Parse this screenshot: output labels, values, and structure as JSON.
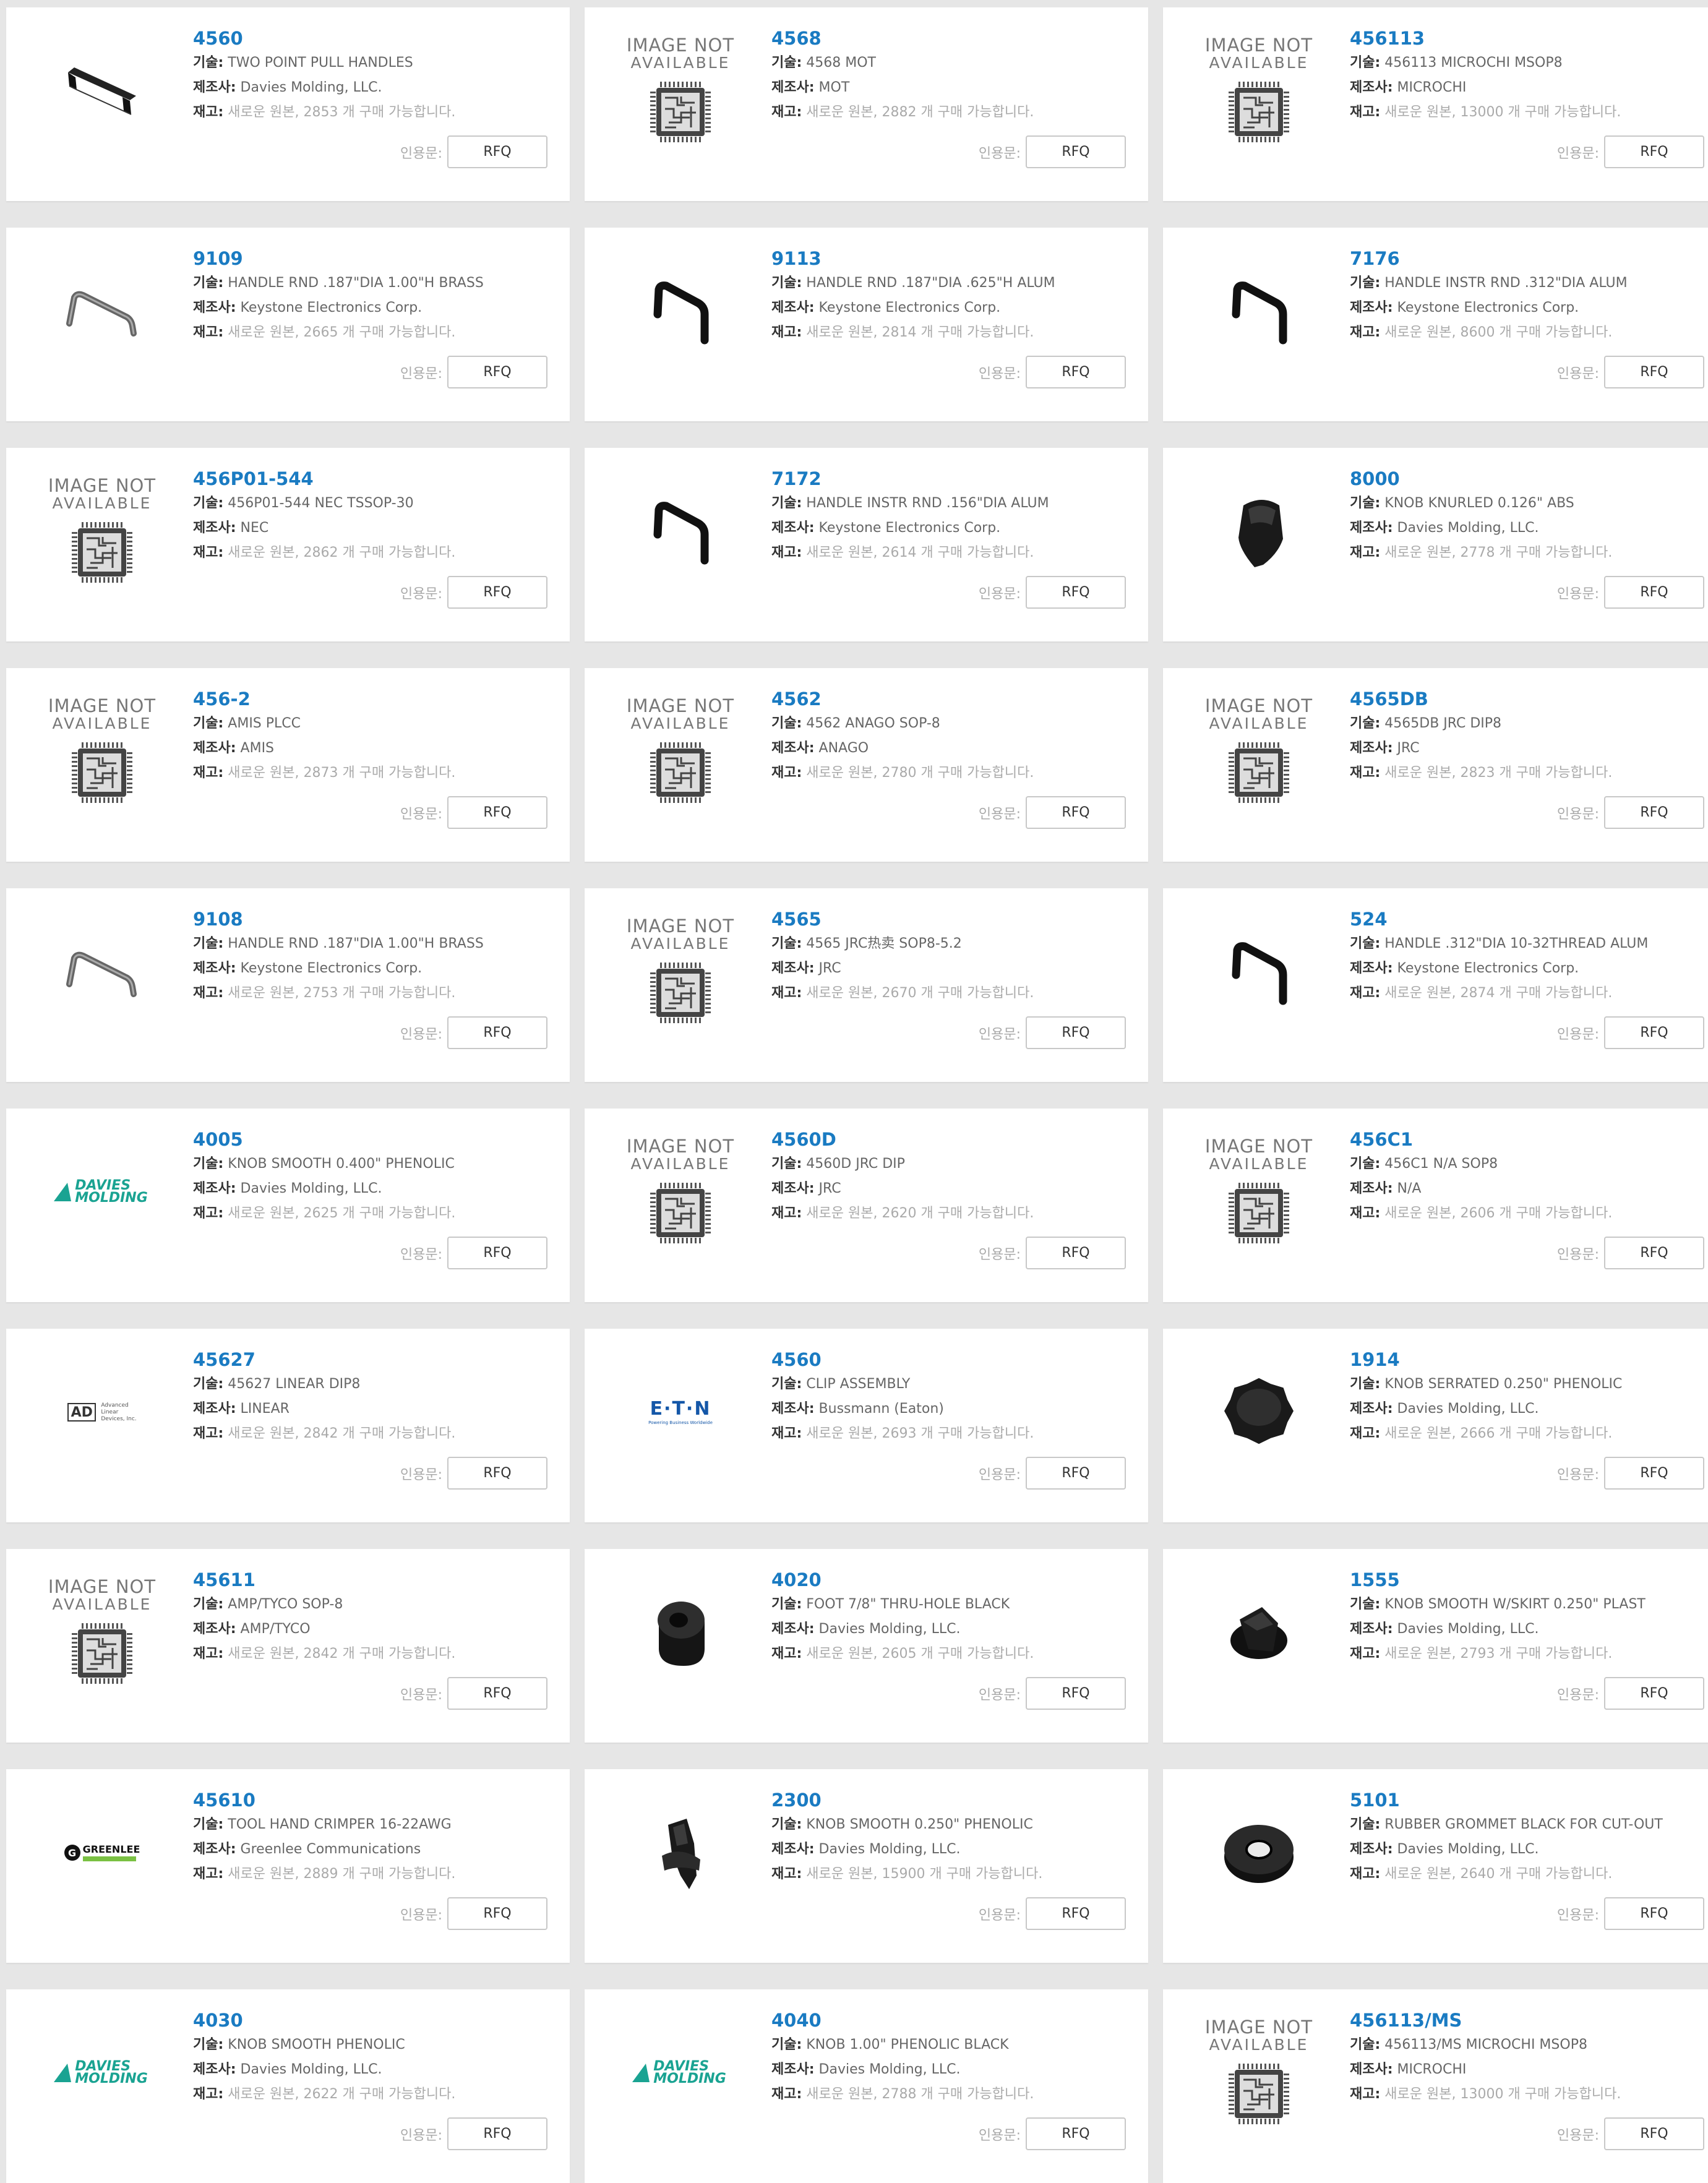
{
  "labels": {
    "desc": "기술:",
    "mfr": "제조사:",
    "stock": "재고:",
    "quote": "인용문:",
    "rfq": "RFQ",
    "image_not_available_1": "IMAGE NOT",
    "image_not_available_2": "AVAILABLE"
  },
  "logos": {
    "davies_line1": "DAVIES",
    "davies_line2": "MOLDING",
    "eaton": "E·T·N",
    "eaton_tagline": "Powering Business Worldwide",
    "greenlee_mark": "G",
    "greenlee": "GREENLEE",
    "ald_mark": "AD",
    "ald_line1": "Advanced",
    "ald_line2": "Linear",
    "ald_line3": "Devices, Inc."
  },
  "colors": {
    "link": "#1a7bc2",
    "davies": "#1aa392",
    "eaton": "#1457a8",
    "greenlee": "#7ac143"
  },
  "products": [
    {
      "pn": "4560",
      "desc": "TWO POINT PULL HANDLES",
      "mfr": "Davies Molding, LLC.",
      "stock": "새로운 원본, 2853 개 구매 가능합니다.",
      "thumb": "pull-handle"
    },
    {
      "pn": "4568",
      "desc": "4568 MOT",
      "mfr": "MOT",
      "stock": "새로운 원본, 2882 개 구매 가능합니다.",
      "thumb": "image-not-available"
    },
    {
      "pn": "456113",
      "desc": "456113 MICROCHI MSOP8",
      "mfr": "MICROCHI",
      "stock": "새로운 원본, 13000 개 구매 가능합니다.",
      "thumb": "image-not-available"
    },
    {
      "pn": "9109",
      "desc": "HANDLE RND .187\"DIA 1.00\"H BRASS",
      "mfr": "Keystone Electronics Corp.",
      "stock": "새로운 원본, 2665 개 구매 가능합니다.",
      "thumb": "handle-silver"
    },
    {
      "pn": "9113",
      "desc": "HANDLE RND .187\"DIA .625\"H ALUM",
      "mfr": "Keystone Electronics Corp.",
      "stock": "새로운 원본, 2814 개 구매 가능합니다.",
      "thumb": "handle-black"
    },
    {
      "pn": "7176",
      "desc": "HANDLE INSTR RND .312\"DIA ALUM",
      "mfr": "Keystone Electronics Corp.",
      "stock": "새로운 원본, 8600 개 구매 가능합니다.",
      "thumb": "handle-black"
    },
    {
      "pn": "456P01-544",
      "desc": "456P01-544 NEC TSSOP-30",
      "mfr": "NEC",
      "stock": "새로운 원본, 2862 개 구매 가능합니다.",
      "thumb": "image-not-available"
    },
    {
      "pn": "7172",
      "desc": "HANDLE INSTR RND .156\"DIA ALUM",
      "mfr": "Keystone Electronics Corp.",
      "stock": "새로운 원본, 2614 개 구매 가능합니다.",
      "thumb": "handle-black"
    },
    {
      "pn": "8000",
      "desc": "KNOB KNURLED 0.126\" ABS",
      "mfr": "Davies Molding, LLC.",
      "stock": "새로운 원본, 2778 개 구매 가능합니다.",
      "thumb": "knob-pointer"
    },
    {
      "pn": "456-2",
      "desc": "AMIS PLCC",
      "mfr": "AMIS",
      "stock": "새로운 원본, 2873 개 구매 가능합니다.",
      "thumb": "image-not-available"
    },
    {
      "pn": "4562",
      "desc": "4562 ANAGO SOP-8",
      "mfr": "ANAGO",
      "stock": "새로운 원본, 2780 개 구매 가능합니다.",
      "thumb": "image-not-available"
    },
    {
      "pn": "4565DB",
      "desc": "4565DB JRC DIP8",
      "mfr": "JRC",
      "stock": "새로운 원본, 2823 개 구매 가능합니다.",
      "thumb": "image-not-available"
    },
    {
      "pn": "9108",
      "desc": "HANDLE RND .187\"DIA 1.00\"H BRASS",
      "mfr": "Keystone Electronics Corp.",
      "stock": "새로운 원본, 2753 개 구매 가능합니다.",
      "thumb": "handle-silver"
    },
    {
      "pn": "4565",
      "desc": "4565 JRC热卖 SOP8-5.2",
      "mfr": "JRC",
      "stock": "새로운 원본, 2670 개 구매 가능합니다.",
      "thumb": "image-not-available"
    },
    {
      "pn": "524",
      "desc": "HANDLE .312\"DIA 10-32THREAD ALUM",
      "mfr": "Keystone Electronics Corp.",
      "stock": "새로운 원본, 2874 개 구매 가능합니다.",
      "thumb": "handle-black"
    },
    {
      "pn": "4005",
      "desc": "KNOB SMOOTH 0.400\" PHENOLIC",
      "mfr": "Davies Molding, LLC.",
      "stock": "새로운 원본, 2625 개 구매 가능합니다.",
      "thumb": "davies-logo"
    },
    {
      "pn": "4560D",
      "desc": "4560D JRC DIP",
      "mfr": "JRC",
      "stock": "새로운 원본, 2620 개 구매 가능합니다.",
      "thumb": "image-not-available"
    },
    {
      "pn": "456C1",
      "desc": "456C1 N/A SOP8",
      "mfr": "N/A",
      "stock": "새로운 원본, 2606 개 구매 가능합니다.",
      "thumb": "image-not-available"
    },
    {
      "pn": "45627",
      "desc": "45627 LINEAR DIP8",
      "mfr": "LINEAR",
      "stock": "새로운 원본, 2842 개 구매 가능합니다.",
      "thumb": "ald-logo"
    },
    {
      "pn": "4560",
      "desc": "CLIP ASSEMBLY",
      "mfr": "Bussmann (Eaton)",
      "stock": "새로운 원본, 2693 개 구매 가능합니다.",
      "thumb": "eaton-logo"
    },
    {
      "pn": "1914",
      "desc": "KNOB SERRATED 0.250\" PHENOLIC",
      "mfr": "Davies Molding, LLC.",
      "stock": "새로운 원본, 2666 개 구매 가능합니다.",
      "thumb": "knob-serrated"
    },
    {
      "pn": "45611",
      "desc": "AMP/TYCO SOP-8",
      "mfr": "AMP/TYCO",
      "stock": "새로운 원본, 2842 개 구매 가능합니다.",
      "thumb": "image-not-available"
    },
    {
      "pn": "4020",
      "desc": "FOOT 7/8\" THRU-HOLE BLACK",
      "mfr": "Davies Molding, LLC.",
      "stock": "새로운 원본, 2605 개 구매 가능합니다.",
      "thumb": "foot"
    },
    {
      "pn": "1555",
      "desc": "KNOB SMOOTH W/SKIRT 0.250\" PLAST",
      "mfr": "Davies Molding, LLC.",
      "stock": "새로운 원본, 2793 개 구매 가능합니다.",
      "thumb": "knob-skirt"
    },
    {
      "pn": "45610",
      "desc": "TOOL HAND CRIMPER 16-22AWG",
      "mfr": "Greenlee Communications",
      "stock": "새로운 원본, 2889 개 구매 가능합니다.",
      "thumb": "greenlee-logo"
    },
    {
      "pn": "2300",
      "desc": "KNOB SMOOTH 0.250\" PHENOLIC",
      "mfr": "Davies Molding, LLC.",
      "stock": "새로운 원본, 15900 개 구매 가능합니다.",
      "thumb": "knob-pointer-tall"
    },
    {
      "pn": "5101",
      "desc": "RUBBER GROMMET BLACK FOR CUT-OUT",
      "mfr": "Davies Molding, LLC.",
      "stock": "새로운 원본, 2640 개 구매 가능합니다.",
      "thumb": "grommet"
    },
    {
      "pn": "4030",
      "desc": "KNOB SMOOTH PHENOLIC",
      "mfr": "Davies Molding, LLC.",
      "stock": "새로운 원본, 2622 개 구매 가능합니다.",
      "thumb": "davies-logo"
    },
    {
      "pn": "4040",
      "desc": "KNOB 1.00\" PHENOLIC BLACK",
      "mfr": "Davies Molding, LLC.",
      "stock": "새로운 원본, 2788 개 구매 가능합니다.",
      "thumb": "davies-logo"
    },
    {
      "pn": "456113/MS",
      "desc": "456113/MS MICROCHI MSOP8",
      "mfr": "MICROCHI",
      "stock": "새로운 원본, 13000 개 구매 가능합니다.",
      "thumb": "image-not-available"
    }
  ]
}
